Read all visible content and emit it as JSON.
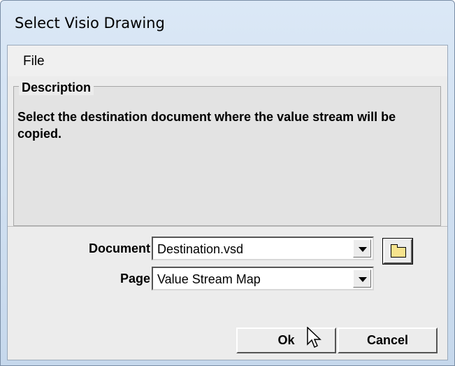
{
  "window": {
    "title": "Select Visio Drawing"
  },
  "menu": {
    "items": [
      "File"
    ]
  },
  "description": {
    "label": "Description",
    "text": "Select the destination document where the value stream will be copied."
  },
  "form": {
    "document": {
      "label": "Document",
      "value": "Destination.vsd"
    },
    "page": {
      "label": "Page",
      "value": "Value Stream Map"
    }
  },
  "buttons": {
    "ok": "Ok",
    "cancel": "Cancel"
  },
  "icons": {
    "browse": "folder-open-icon",
    "dropdown": "chevron-down-icon",
    "cursor": "mouse-pointer-icon"
  },
  "colors": {
    "titlebar_top": "#dbe8f6",
    "titlebar_bottom": "#c6d8ec",
    "client": "#ececec"
  }
}
